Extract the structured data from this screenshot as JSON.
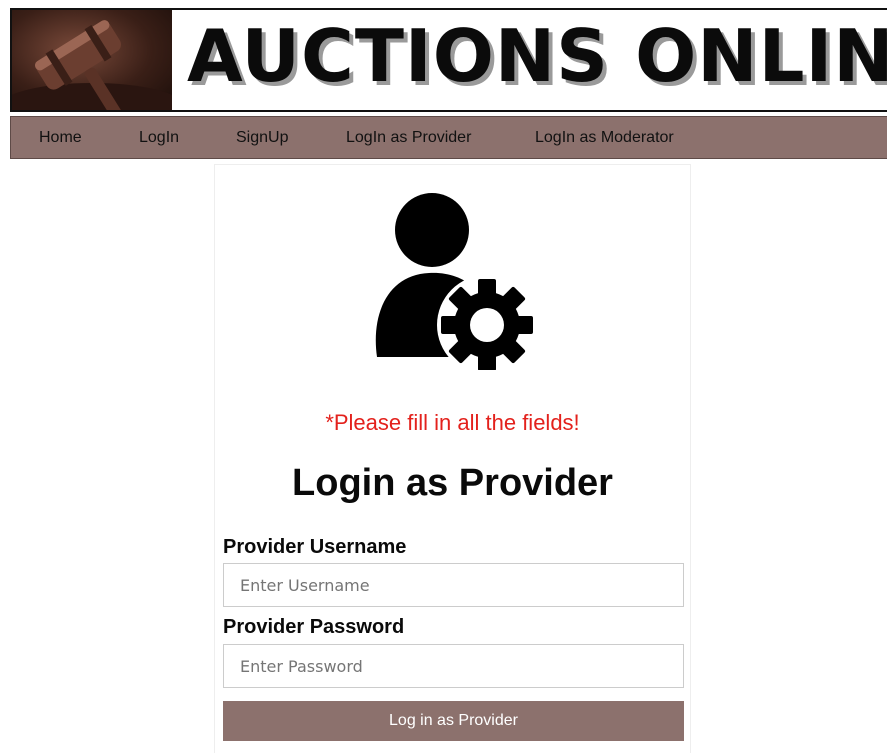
{
  "header": {
    "title": "AUCTIONS ONLINE",
    "logo_icon": "gavel-icon"
  },
  "nav": {
    "items": [
      {
        "label": "Home"
      },
      {
        "label": "LogIn"
      },
      {
        "label": "SignUp"
      },
      {
        "label": "LogIn as Provider"
      },
      {
        "label": "LogIn as Moderator"
      }
    ]
  },
  "colors": {
    "nav_background": "#8c716d",
    "button_background": "#8c716d",
    "error_text": "#e3211c"
  },
  "form": {
    "avatar_icon": "user-gear-icon",
    "error_message": "*Please fill in all the fields!",
    "title": "Login as Provider",
    "username": {
      "label": "Provider Username",
      "placeholder": "Enter Username",
      "value": ""
    },
    "password": {
      "label": "Provider Password",
      "placeholder": "Enter Password",
      "value": ""
    },
    "submit_label": "Log in as Provider"
  }
}
